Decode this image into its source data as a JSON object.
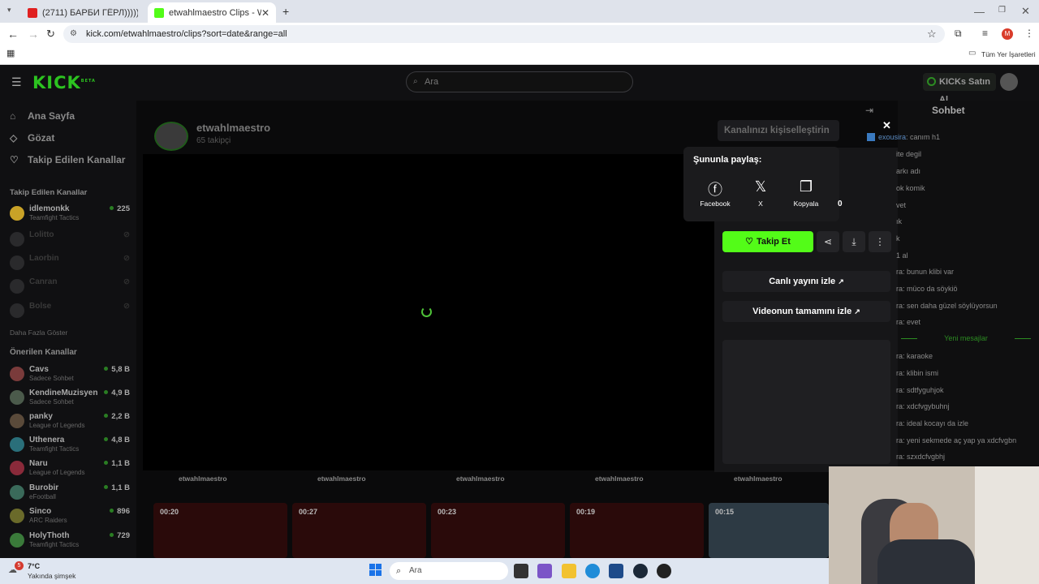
{
  "browser": {
    "tabs": [
      {
        "title": "(2711) БАРБИ ГЁРЛ))))))))) - Yo",
        "active": false
      },
      {
        "title": "etwahlmaestro Clips - Watch Li",
        "active": true
      }
    ],
    "new_tab": "+",
    "url": "kick.com/etwahlmaestro/clips?sort=date&range=all",
    "profile_initial": "M",
    "bookmarks_label": "Tüm Yer İşaretleri"
  },
  "header": {
    "logo": "KICK",
    "logo_badge": "BETA",
    "search_placeholder": "Ara",
    "buy_kicks": "KICKs Satın Al"
  },
  "sidebar": {
    "nav": [
      {
        "label": "Ana Sayfa",
        "icon": "home-icon"
      },
      {
        "label": "Gözat",
        "icon": "compass-icon"
      },
      {
        "label": "Takip Edilen Kanallar",
        "icon": "heart-icon"
      }
    ],
    "followed_title": "Takip Edilen Kanallar",
    "followed": [
      {
        "name": "idlemonkk",
        "category": "Teamfight Tactics",
        "viewers": "225",
        "live": true
      },
      {
        "name": "Lolitto",
        "category": "",
        "viewers": "",
        "live": false
      },
      {
        "name": "Laorbin",
        "category": "",
        "viewers": "",
        "live": false
      },
      {
        "name": "Canran",
        "category": "",
        "viewers": "",
        "live": false
      },
      {
        "name": "Bolse",
        "category": "",
        "viewers": "",
        "live": false
      }
    ],
    "show_more": "Daha Fazla Göster",
    "recommended_title": "Önerilen Kanallar",
    "recommended": [
      {
        "name": "Cavs",
        "category": "Sadece Sohbet",
        "viewers": "5,8 B"
      },
      {
        "name": "KendineMuzisyen",
        "category": "Sadece Sohbet",
        "viewers": "4,9 B"
      },
      {
        "name": "panky",
        "category": "League of Legends",
        "viewers": "2,2 B"
      },
      {
        "name": "Uthenera",
        "category": "Teamfight Tactics",
        "viewers": "4,8 B"
      },
      {
        "name": "Naru",
        "category": "League of Legends",
        "viewers": "1,1 B"
      },
      {
        "name": "Burobir",
        "category": "eFootball",
        "viewers": "1,1 B"
      },
      {
        "name": "Sinco",
        "category": "ARC Raiders",
        "viewers": "896"
      },
      {
        "name": "HolyThoth",
        "category": "Teamfight Tactics",
        "viewers": "729"
      }
    ]
  },
  "channel": {
    "name": "etwahlmaestro",
    "followers": "65 takipçi",
    "customize": "Kanalınızı kişiselleştirin"
  },
  "share": {
    "title": "Şununla paylaş:",
    "options": [
      {
        "label": "Facebook",
        "icon": "facebook-icon"
      },
      {
        "label": "X",
        "icon": "x-logo-icon"
      },
      {
        "label": "Kopyala",
        "icon": "copy-icon"
      }
    ],
    "count": "0"
  },
  "panel": {
    "follow": "Takip Et",
    "watch_live": "Canlı yayını izle",
    "watch_full": "Videonun tamamını izle"
  },
  "clips": {
    "labels": [
      "etwahlmaestro",
      "etwahlmaestro",
      "etwahlmaestro",
      "etwahlmaestro",
      "etwahlmaestro"
    ],
    "durations": [
      "00:20",
      "00:27",
      "00:23",
      "00:19",
      "00:15"
    ]
  },
  "chat": {
    "title": "Sohbet",
    "messages": [
      {
        "user": "exousira",
        "text": "canım h1"
      },
      {
        "user": "",
        "text": "ite degil"
      },
      {
        "user": "",
        "text": "arkı adı"
      },
      {
        "user": "",
        "text": "ok komik"
      },
      {
        "user": "",
        "text": "vet"
      },
      {
        "user": "",
        "text": "ık"
      },
      {
        "user": "",
        "text": "k"
      },
      {
        "user": "",
        "text": "1 al"
      },
      {
        "user": "",
        "text": "ra: bunun klibi var"
      },
      {
        "user": "",
        "text": "ra: müco da söykiö"
      },
      {
        "user": "",
        "text": "ra: sen daha güzel söylüyorsun"
      },
      {
        "user": "",
        "text": "ra: evet"
      }
    ],
    "new_messages": "Yeni mesajlar",
    "messages_after": [
      {
        "text": "ra: karaoke"
      },
      {
        "text": "ra: klibin ismi"
      },
      {
        "text": "ra: sdtfyguhjok"
      },
      {
        "text": "ra: xdcfvgybuhnj"
      },
      {
        "text": "ra: ideal kocayı da izle"
      },
      {
        "text": "ra: yeni sekmede aç yap ya xdcfvgbn"
      },
      {
        "text": "ra: szxdcfvgbhj"
      }
    ]
  },
  "taskbar": {
    "weather_temp": "7°C",
    "weather_desc": "Yakında şimşek",
    "notif_count": "5",
    "search_placeholder": "Ara"
  },
  "colors": {
    "accent": "#53fc18",
    "live_dot": "#2a7d23"
  }
}
